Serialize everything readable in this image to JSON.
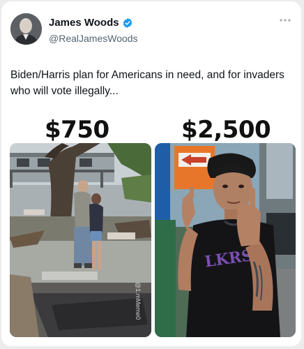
{
  "author": {
    "display_name": "James Woods",
    "handle": "@RealJamesWoods",
    "verified": true
  },
  "tweet": {
    "text": "Biden/Harris plan for Americans in need, and for invaders who will vote illegally..."
  },
  "meme": {
    "left_caption": "$750",
    "right_caption": "$2,500",
    "watermark": "@1.mMeme0"
  },
  "icons": {
    "verified": "verified-badge-icon",
    "more": "more-options-icon"
  },
  "colors": {
    "verified_blue": "#1d9bf0",
    "text_primary": "#0f1419",
    "text_secondary": "#536471"
  }
}
